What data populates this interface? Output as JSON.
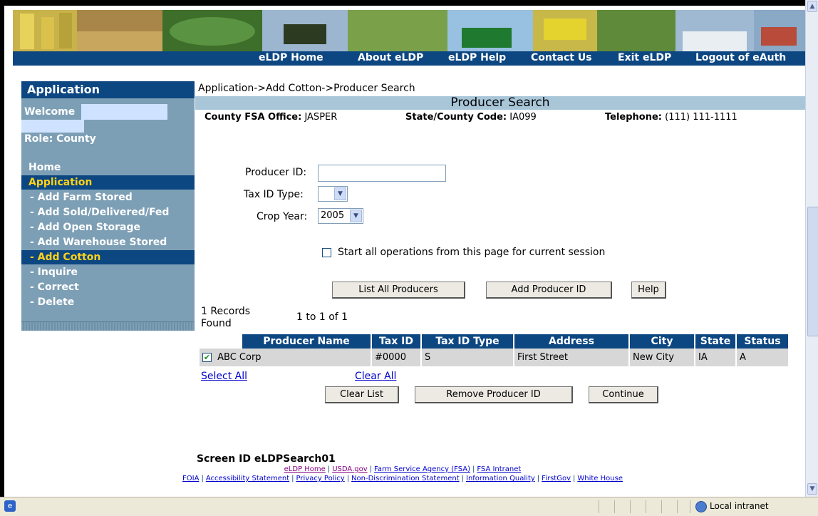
{
  "nav": {
    "home": "eLDP Home",
    "about": "About eLDP",
    "help": "eLDP Help",
    "contact": "Contact Us",
    "exit": "Exit eLDP",
    "logout": "Logout of eAuth"
  },
  "sidebar": {
    "header": "Application",
    "welcome": "Welcome",
    "role": "Role: County",
    "items": [
      {
        "label": "Home"
      },
      {
        "label": "Application"
      },
      {
        "label": " - Add Farm Stored"
      },
      {
        "label": " - Add Sold/Delivered/Fed"
      },
      {
        "label": " - Add Open Storage"
      },
      {
        "label": " - Add Warehouse Stored"
      },
      {
        "label": " - Add Cotton"
      },
      {
        "label": " - Inquire"
      },
      {
        "label": " - Correct"
      },
      {
        "label": " - Delete"
      }
    ]
  },
  "breadcrumb": "Application->Add Cotton->Producer Search",
  "page_title": "Producer Search",
  "office": {
    "county_label": "County FSA Office:",
    "county_value": "JASPER",
    "code_label": "State/County Code:",
    "code_value": "IA099",
    "phone_label": "Telephone:",
    "phone_value": "(111) 111-1111"
  },
  "form": {
    "producer_id_label": "Producer ID:",
    "producer_id_value": "",
    "tax_id_type_label": "Tax ID Type:",
    "tax_id_type_value": "",
    "crop_year_label": "Crop Year:",
    "crop_year_value": "2005",
    "session_checkbox_label": "Start all operations from this page for current session",
    "session_checkbox_checked": false
  },
  "buttons": {
    "list_all": "List All Producers",
    "add_producer": "Add Producer ID",
    "help": "Help",
    "clear_list": "Clear List",
    "remove_producer": "Remove Producer ID",
    "continue": "Continue"
  },
  "records": {
    "found": "1 Records Found",
    "range": "1 to 1 of 1"
  },
  "table": {
    "columns": [
      "Producer Name",
      "Tax ID",
      "Tax ID Type",
      "Address",
      "City",
      "State",
      "Status"
    ],
    "rows": [
      {
        "checked": true,
        "name": "ABC Corp",
        "tax_id": "#0000",
        "tax_id_type": "S",
        "address": "First Street",
        "city": "New City",
        "state": "IA",
        "status": "A"
      }
    ]
  },
  "select_all": "Select All",
  "clear_all": "Clear All",
  "screen_id": "Screen ID eLDPSearch01",
  "footer": {
    "line1": [
      "eLDP Home",
      "USDA.gov",
      "Farm Service Agency (FSA)",
      "FSA Intranet"
    ],
    "line2": [
      "FOIA",
      "Accessibility Statement",
      "Privacy Policy",
      "Non-Discrimination Statement",
      "Information Quality",
      "FirstGov",
      "White House"
    ]
  },
  "statusbar": {
    "zone": "Local intranet"
  },
  "colors": {
    "navy": "#0d4782",
    "sidebar": "#7d9fb5",
    "title_bar": "#a9c6d9",
    "highlight": "#ffd21a"
  }
}
